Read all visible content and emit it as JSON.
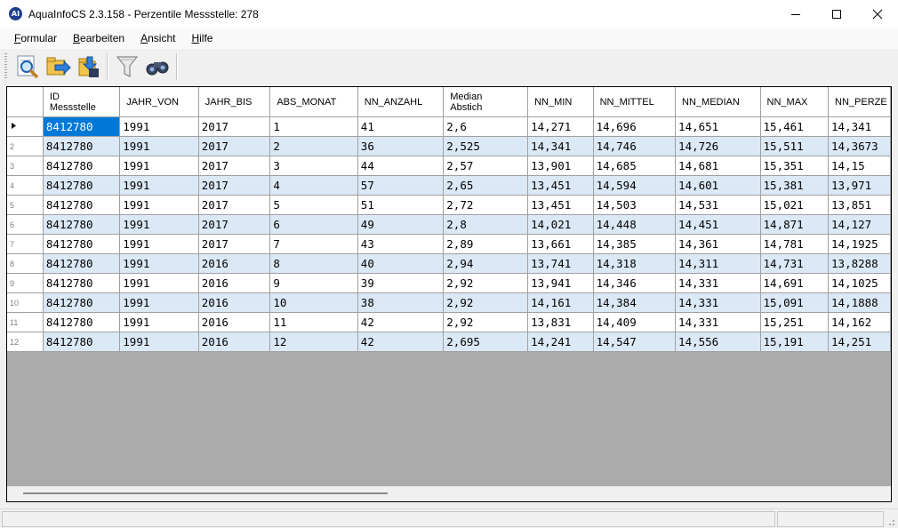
{
  "window": {
    "app_icon_text": "AI",
    "title": "AquaInfoCS 2.3.158 - Perzentile Messstelle: 278"
  },
  "menu": [
    {
      "mnemonic": "F",
      "rest": "ormular"
    },
    {
      "mnemonic": "B",
      "rest": "earbeiten"
    },
    {
      "mnemonic": "A",
      "rest": "nsicht"
    },
    {
      "mnemonic": "H",
      "rest": "ilfe"
    }
  ],
  "toolbar": {
    "icons": [
      "search-document-icon",
      "export-icon",
      "import-icon",
      "filter-icon",
      "binoculars-icon"
    ]
  },
  "grid": {
    "columns": [
      {
        "line1": "ID",
        "line2": "Messstelle"
      },
      {
        "line1": "JAHR_VON",
        "line2": ""
      },
      {
        "line1": "JAHR_BIS",
        "line2": ""
      },
      {
        "line1": "ABS_MONAT",
        "line2": ""
      },
      {
        "line1": "NN_ANZAHL",
        "line2": ""
      },
      {
        "line1": "Median",
        "line2": "Abstich"
      },
      {
        "line1": "NN_MIN",
        "line2": ""
      },
      {
        "line1": "NN_MITTEL",
        "line2": ""
      },
      {
        "line1": "NN_MEDIAN",
        "line2": ""
      },
      {
        "line1": "NN_MAX",
        "line2": ""
      },
      {
        "line1": "NN_PERZE",
        "line2": ""
      }
    ],
    "rows": [
      {
        "num": "",
        "cells": [
          "8412780",
          "1991",
          "2017",
          "1",
          "41",
          "2,6",
          "14,271",
          "14,696",
          "14,651",
          "15,461",
          "14,341"
        ]
      },
      {
        "num": "2",
        "cells": [
          "8412780",
          "1991",
          "2017",
          "2",
          "36",
          "2,525",
          "14,341",
          "14,746",
          "14,726",
          "15,511",
          "14,3673"
        ]
      },
      {
        "num": "3",
        "cells": [
          "8412780",
          "1991",
          "2017",
          "3",
          "44",
          "2,57",
          "13,901",
          "14,685",
          "14,681",
          "15,351",
          "14,15"
        ]
      },
      {
        "num": "4",
        "cells": [
          "8412780",
          "1991",
          "2017",
          "4",
          "57",
          "2,65",
          "13,451",
          "14,594",
          "14,601",
          "15,381",
          "13,971"
        ]
      },
      {
        "num": "5",
        "cells": [
          "8412780",
          "1991",
          "2017",
          "5",
          "51",
          "2,72",
          "13,451",
          "14,503",
          "14,531",
          "15,021",
          "13,851"
        ]
      },
      {
        "num": "6",
        "cells": [
          "8412780",
          "1991",
          "2017",
          "6",
          "49",
          "2,8",
          "14,021",
          "14,448",
          "14,451",
          "14,871",
          "14,127"
        ]
      },
      {
        "num": "7",
        "cells": [
          "8412780",
          "1991",
          "2017",
          "7",
          "43",
          "2,89",
          "13,661",
          "14,385",
          "14,361",
          "14,781",
          "14,1925"
        ]
      },
      {
        "num": "8",
        "cells": [
          "8412780",
          "1991",
          "2016",
          "8",
          "40",
          "2,94",
          "13,741",
          "14,318",
          "14,311",
          "14,731",
          "13,8288"
        ]
      },
      {
        "num": "9",
        "cells": [
          "8412780",
          "1991",
          "2016",
          "9",
          "39",
          "2,92",
          "13,941",
          "14,346",
          "14,331",
          "14,691",
          "14,1025"
        ]
      },
      {
        "num": "10",
        "cells": [
          "8412780",
          "1991",
          "2016",
          "10",
          "38",
          "2,92",
          "14,161",
          "14,384",
          "14,331",
          "15,091",
          "14,1888"
        ]
      },
      {
        "num": "11",
        "cells": [
          "8412780",
          "1991",
          "2016",
          "11",
          "42",
          "2,92",
          "13,831",
          "14,409",
          "14,331",
          "15,251",
          "14,162"
        ]
      },
      {
        "num": "12",
        "cells": [
          "8412780",
          "1991",
          "2016",
          "12",
          "42",
          "2,695",
          "14,241",
          "14,547",
          "14,556",
          "15,191",
          "14,251"
        ]
      }
    ]
  },
  "colors": {
    "alt_row": "#dbe9f7",
    "selection": "#0078d7",
    "empty_area": "#ababab"
  }
}
